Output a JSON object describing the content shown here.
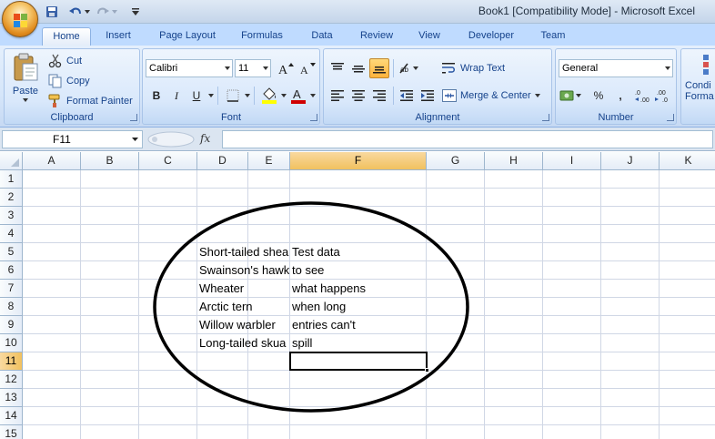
{
  "window": {
    "title": "Book1  [Compatibility Mode] - Microsoft Excel"
  },
  "tabs": [
    "Home",
    "Insert",
    "Page Layout",
    "Formulas",
    "Data",
    "Review",
    "View",
    "Developer",
    "Team"
  ],
  "active_tab": "Home",
  "clipboard": {
    "paste": "Paste",
    "cut": "Cut",
    "copy": "Copy",
    "format_painter": "Format Painter",
    "label": "Clipboard"
  },
  "font": {
    "name": "Calibri",
    "size": "11",
    "label": "Font",
    "bold": "B",
    "italic": "I",
    "underline": "U",
    "font_color": "#d00000",
    "fill_color": "#ffff00"
  },
  "alignment": {
    "wrap_text": "Wrap Text",
    "merge_center": "Merge & Center",
    "label": "Alignment"
  },
  "number": {
    "format": "General",
    "percent": "%",
    "comma": ",",
    "label": "Number"
  },
  "styles": {
    "conditional_formatting": "Condi Forma"
  },
  "formula_bar": {
    "name_box": "F11",
    "fx": "fx",
    "content": ""
  },
  "sheet": {
    "columns": [
      "A",
      "B",
      "C",
      "D",
      "E",
      "F",
      "G",
      "H",
      "I",
      "J",
      "K"
    ],
    "selected_column": "F",
    "rows": [
      "1",
      "2",
      "3",
      "4",
      "5",
      "6",
      "7",
      "8",
      "9",
      "10",
      "11",
      "12",
      "13",
      "14",
      "15"
    ],
    "selected_row": "11",
    "active_cell": "F11",
    "column_d": [
      "Short-tailed shearwater",
      "Swainson's hawk",
      "Wheater",
      "Arctic tern",
      "Willow warbler",
      "Long-tailed skua"
    ],
    "column_f": [
      "Test data",
      "to see",
      "what happens",
      "when long",
      "entries can't",
      "spill"
    ]
  },
  "colors": {
    "ribbon_bg": "#d6e6fa",
    "selected_header": "#f1c15f",
    "annotation_ellipse": "#000000"
  }
}
